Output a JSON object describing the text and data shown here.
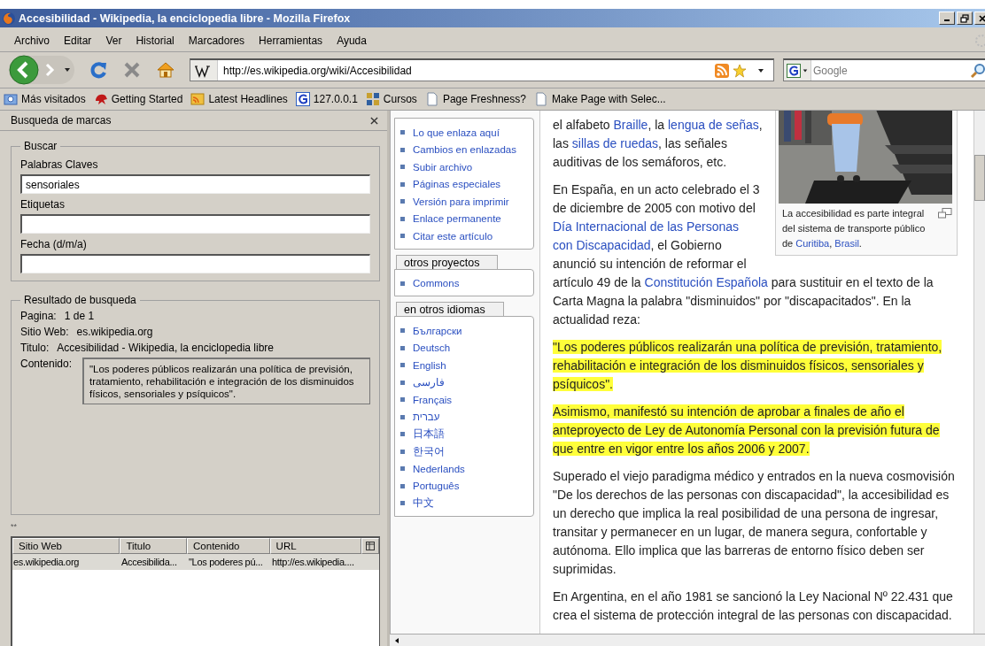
{
  "window": {
    "title": "Accesibilidad - Wikipedia, la enciclopedia libre - Mozilla Firefox"
  },
  "menu": [
    "Archivo",
    "Editar",
    "Ver",
    "Historial",
    "Marcadores",
    "Herramientas",
    "Ayuda"
  ],
  "url_bar": {
    "value": "http://es.wikipedia.org/wiki/Accesibilidad"
  },
  "search_bar": {
    "placeholder": "Google"
  },
  "bookmarks": [
    {
      "label": "Más visitados",
      "kind": "folder"
    },
    {
      "label": "Getting Started",
      "kind": "dragon"
    },
    {
      "label": "Latest Headlines",
      "kind": "feed"
    },
    {
      "label": "127.0.0.1",
      "kind": "google"
    },
    {
      "label": "Cursos",
      "kind": "cursos"
    },
    {
      "label": "Page Freshness?",
      "kind": "page"
    },
    {
      "label": "Make Page with Selec...",
      "kind": "page"
    }
  ],
  "sidebar": {
    "title": "Busqueda de marcas",
    "search_group": {
      "legend": "Buscar",
      "fields": [
        {
          "label": "Palabras Claves",
          "value": "sensoriales"
        },
        {
          "label": "Etiquetas"
        },
        {
          "label": "Fecha (d/m/a)"
        }
      ]
    },
    "results_group": {
      "legend": "Resultado de busqueda",
      "rows": [
        {
          "label": "Pagina:",
          "value": "1 de 1"
        },
        {
          "label": "Sitio Web:",
          "value": "es.wikipedia.org"
        },
        {
          "label": "Titulo:",
          "value": "Accesibilidad - Wikipedia, la enciclopedia libre"
        }
      ],
      "content_label": "Contenido:",
      "content": "\"Los poderes públicos realizarán una política de previsión, tratamiento, rehabilitación e integración de los disminuidos físicos, sensoriales y psíquicos\"."
    },
    "marker": "**",
    "table": {
      "columns": [
        "Sitio Web",
        "Titulo",
        "Contenido",
        "URL"
      ],
      "rows": [
        {
          "selected": true,
          "cells": [
            "es.wikipedia.org",
            "Accesibilida...",
            "\"Los poderes pú...",
            "http://es.wikipedia...."
          ]
        }
      ]
    }
  },
  "portlets": [
    {
      "links": [
        "Lo que enlaza aquí",
        "Cambios en enlazadas",
        "Subir archivo",
        "Páginas especiales",
        "Versión para imprimir",
        "Enlace permanente",
        "Citar este artículo"
      ]
    },
    {
      "title": "otros proyectos",
      "links": [
        "Commons"
      ]
    },
    {
      "title": "en otros idiomas",
      "links": [
        "Български",
        "Deutsch",
        "English",
        "فارسی",
        "Français",
        "עברית",
        "日本語",
        "한국어",
        "Nederlands",
        "Português",
        "中文"
      ]
    }
  ],
  "figure": {
    "kind": "picture",
    "caption": [
      {
        "kind": "text",
        "text": "La accesibilidad es parte integral del sistema de transporte público de"
      },
      {
        "kind": "link",
        "text": "Curitiba"
      },
      {
        "kind": "text",
        "text": ","
      },
      {
        "kind": "link",
        "text": "Brasil"
      },
      {
        "kind": "text",
        "text": "."
      }
    ]
  },
  "lead": [
    {
      "segments": [
        {
          "kind": "text",
          "text": "el alfabeto"
        },
        {
          "kind": "link",
          "text": "Braille"
        },
        {
          "kind": "text",
          "text": ", la"
        },
        {
          "kind": "link",
          "text": "lengua de"
        },
        {
          "kind": "link",
          "text": "señas"
        },
        {
          "kind": "text",
          "text": ", las"
        },
        {
          "kind": "link",
          "text": "sillas de ruedas"
        },
        {
          "kind": "text",
          "text": ", las señales auditivas de los semáforos, etc."
        }
      ]
    },
    {
      "segments": [
        {
          "kind": "text",
          "text": "En España, en un acto celebrado el 3 de diciembre de 2005 con motivo del"
        },
        {
          "kind": "link",
          "text": "Día Internacional de las Personas"
        },
        {
          "kind": "link",
          "text": "con Discapacidad"
        },
        {
          "kind": "text",
          "text": ", el Gobierno anunció su intención de reformar el"
        }
      ]
    }
  ],
  "paragraphs": [
    {
      "kind": "continued",
      "highlighted": false,
      "segments": [
        {
          "kind": "text",
          "text": "artículo 49 de la"
        },
        {
          "kind": "link",
          "text": "Constitución Española"
        },
        {
          "kind": "text",
          "text": "para sustituir en el texto de la Carta Magna la palabra \"disminuidos\" por \"discapacitados\". En la actualidad reza:"
        }
      ]
    },
    {
      "kind": "paragraph",
      "highlighted": true,
      "segments": [
        {
          "kind": "text",
          "text": "\"Los poderes públicos realizarán una política de previsión, tratamiento, rehabilitación e integración de los disminuidos físicos, sensoriales y psíquicos\"."
        }
      ]
    },
    {
      "kind": "paragraph",
      "highlighted": true,
      "segments": [
        {
          "kind": "text",
          "text": "Asimismo, manifestó su intención de aprobar a finales de año el anteproyecto de Ley de Autonomía Personal con la previsión futura de que entre en vigor entre los años 2006 y 2007."
        }
      ]
    },
    {
      "kind": "paragraph",
      "highlighted": false,
      "segments": [
        {
          "kind": "text",
          "text": "Superado el viejo paradigma médico y entrados en la nueva cosmovisión \"De los derechos de las personas con discapacidad\", la accesibilidad es un derecho que implica la real posibilidad de una persona de ingresar, transitar y permanecer en un lugar, de manera segura, confortable y autónoma. Ello implica que las barreras de entorno físico deben ser suprimidas."
        }
      ]
    },
    {
      "kind": "paragraph",
      "highlighted": false,
      "segments": [
        {
          "kind": "text",
          "text": "En Argentina, en el año 1981 se sancionó la Ley Nacional Nº 22.431 que crea el sistema de protección integral de las personas con discapacidad."
        }
      ]
    }
  ]
}
